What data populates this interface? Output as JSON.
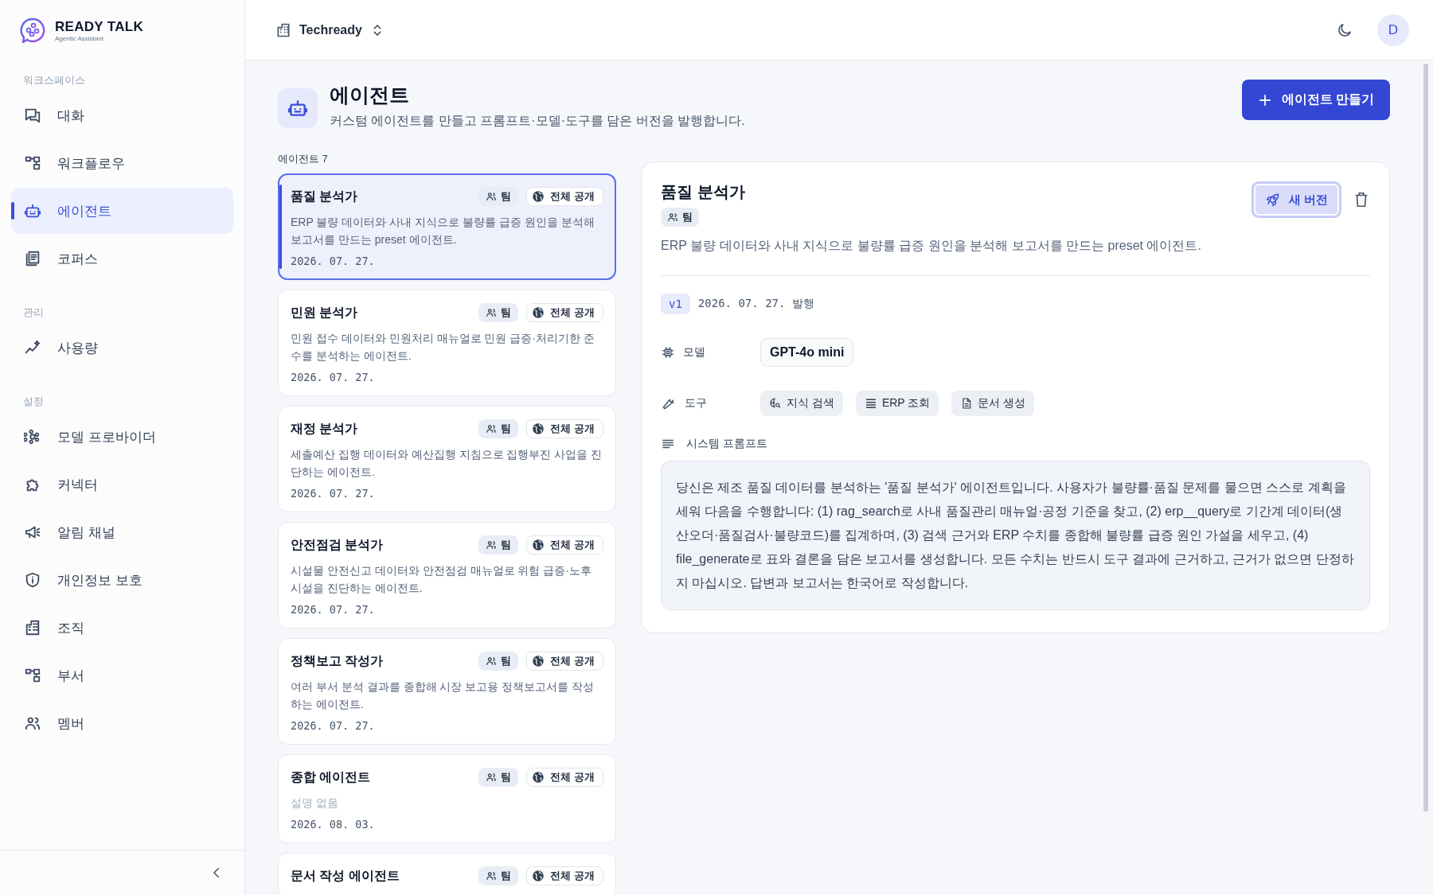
{
  "brand": {
    "name": "READY TALK",
    "tagline": "Agentic Assistant"
  },
  "sidebar": {
    "sections": [
      {
        "title": "워크스페이스",
        "items": [
          {
            "label": "대화",
            "selected": false
          },
          {
            "label": "워크플로우",
            "selected": false
          },
          {
            "label": "에이전트",
            "selected": true
          },
          {
            "label": "코퍼스",
            "selected": false
          }
        ]
      },
      {
        "title": "관리",
        "items": [
          {
            "label": "사용량",
            "selected": false
          }
        ]
      },
      {
        "title": "설정",
        "items": [
          {
            "label": "모델 프로바이더",
            "selected": false
          },
          {
            "label": "커넥터",
            "selected": false
          },
          {
            "label": "알림 채널",
            "selected": false
          },
          {
            "label": "개인정보 보호",
            "selected": false
          },
          {
            "label": "조직",
            "selected": false
          },
          {
            "label": "부서",
            "selected": false
          },
          {
            "label": "멤버",
            "selected": false
          }
        ]
      }
    ]
  },
  "topbar": {
    "organization": "Techready",
    "avatar": "D"
  },
  "page": {
    "title": "에이전트",
    "subtitle": "커스텀 에이전트를 만들고 프롬프트·모델·도구를 담은 버전을 발행합니다.",
    "create_button": "에이전트 만들기"
  },
  "list": {
    "heading": "에이전트 7",
    "agents": [
      {
        "name": "품질 분석가",
        "scope": "팀",
        "visibility": "전체 공개",
        "description": "ERP 불량 데이터와 사내 지식으로 불량률 급증 원인을 분석해 보고서를 만드는 preset 에이전트.",
        "description_missing": false,
        "date": "2026. 07. 27.",
        "selected": true
      },
      {
        "name": "민원 분석가",
        "scope": "팀",
        "visibility": "전체 공개",
        "description": "민원 접수 데이터와 민원처리 매뉴얼로 민원 급증·처리기한 준수를 분석하는 에이전트.",
        "description_missing": false,
        "date": "2026. 07. 27.",
        "selected": false
      },
      {
        "name": "재정 분석가",
        "scope": "팀",
        "visibility": "전체 공개",
        "description": "세출예산 집행 데이터와 예산집행 지침으로 집행부진 사업을 진단하는 에이전트.",
        "description_missing": false,
        "date": "2026. 07. 27.",
        "selected": false
      },
      {
        "name": "안전점검 분석가",
        "scope": "팀",
        "visibility": "전체 공개",
        "description": "시설물 안전신고 데이터와 안전점검 매뉴얼로 위험 급증·노후 시설을 진단하는 에이전트.",
        "description_missing": false,
        "date": "2026. 07. 27.",
        "selected": false
      },
      {
        "name": "정책보고 작성가",
        "scope": "팀",
        "visibility": "전체 공개",
        "description": "여러 부서 분석 결과를 종합해 시장 보고용 정책보고서를 작성하는 에이전트.",
        "description_missing": false,
        "date": "2026. 07. 27.",
        "selected": false
      },
      {
        "name": "종합 에이전트",
        "scope": "팀",
        "visibility": "전체 공개",
        "description": "설명 없음",
        "description_missing": true,
        "date": "2026. 08. 03.",
        "selected": false
      },
      {
        "name": "문서 작성 에이전트",
        "scope": "팀",
        "visibility": "전체 공개",
        "selected": false
      }
    ]
  },
  "detail": {
    "title": "품질 분석가",
    "scope": "팀",
    "new_version_button": "새 버전",
    "description": "ERP 불량 데이터와 사내 지식으로 불량률 급증 원인을 분석해 보고서를 만드는 preset 에이전트.",
    "version": "v1",
    "published": "2026. 07. 27. 발행",
    "model_label": "모델",
    "model": "GPT-4o mini",
    "tools_label": "도구",
    "tools": [
      "지식 검색",
      "ERP 조회",
      "문서 생성"
    ],
    "prompt_label": "시스템 프롬프트",
    "prompt": "당신은 제조 품질 데이터를 분석하는 '품질 분석가' 에이전트입니다. 사용자가 불량률·품질 문제를 물으면 스스로 계획을 세워 다음을 수행합니다: (1) rag_search로 사내 품질관리 매뉴얼·공정 기준을 찾고, (2) erp__query로 기간계 데이터(생산오더·품질검사·불량코드)를 집계하며, (3) 검색 근거와 ERP 수치를 종합해 불량률 급증 원인 가설을 세우고, (4) file_generate로 표와 결론을 담은 보고서를 생성합니다. 모든 수치는 반드시 도구 결과에 근거하고, 근거가 없으면 단정하지 마십시오. 답변과 보고서는 한국어로 작성합니다."
  }
}
